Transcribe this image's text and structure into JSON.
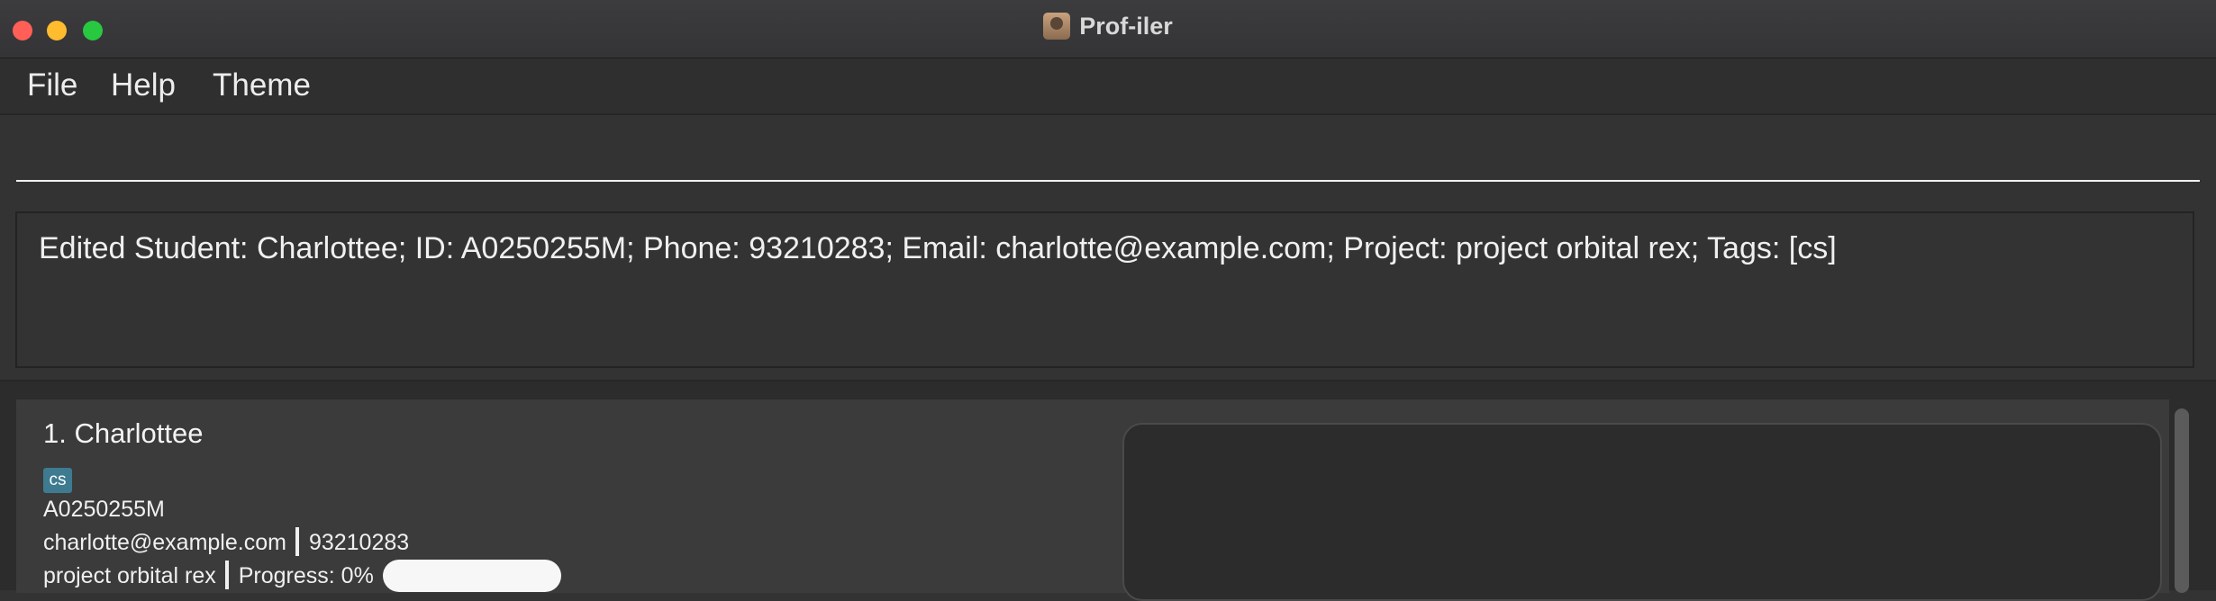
{
  "window": {
    "title": "Prof-iler"
  },
  "menu": {
    "file": "File",
    "help": "Help",
    "theme": "Theme"
  },
  "command": {
    "value": "",
    "placeholder": ""
  },
  "result": {
    "message": "Edited Student: Charlottee; ID: A0250255M; Phone: 93210283; Email: charlotte@example.com; Project: project orbital rex; Tags: [cs]"
  },
  "students": [
    {
      "index_name": "1. Charlottee",
      "tag": "cs",
      "id": "A0250255M",
      "email": "charlotte@example.com",
      "phone": "93210283",
      "project": "project orbital rex",
      "progress_label": "Progress: 0%",
      "progress_value": 0
    }
  ],
  "colors": {
    "tag_background": "#3e7b91",
    "progress_track": "#f7f7f7",
    "close": "#ff5f57",
    "minimize": "#febc2e",
    "maximize": "#28c840"
  }
}
